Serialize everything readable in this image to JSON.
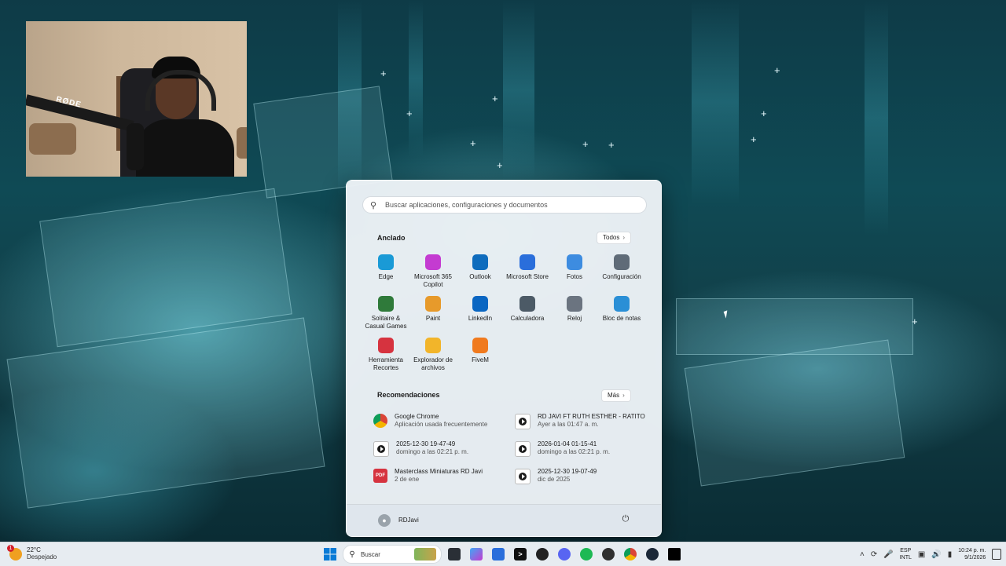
{
  "start_menu": {
    "search_placeholder": "Buscar aplicaciones, configuraciones y documentos",
    "pinned_title": "Anclado",
    "all_button": "Todos",
    "pinned": [
      {
        "label": "Edge",
        "icon": "edge-icon",
        "color": "#1a9ad6"
      },
      {
        "label": "Microsoft 365 Copilot",
        "icon": "m365-copilot-icon",
        "color": "#c43bd1"
      },
      {
        "label": "Outlook",
        "icon": "outlook-icon",
        "color": "#0f6cbd"
      },
      {
        "label": "Microsoft Store",
        "icon": "store-icon",
        "color": "#2a6edb"
      },
      {
        "label": "Fotos",
        "icon": "photos-icon",
        "color": "#3d8ce0"
      },
      {
        "label": "Configuración",
        "icon": "gear-icon",
        "color": "#5f6b78"
      },
      {
        "label": "Solitaire & Casual Games",
        "icon": "solitaire-icon",
        "color": "#2f7a3a"
      },
      {
        "label": "Paint",
        "icon": "paint-icon",
        "color": "#e79a2b"
      },
      {
        "label": "LinkedIn",
        "icon": "linkedin-icon",
        "color": "#0a66c2"
      },
      {
        "label": "Calculadora",
        "icon": "calculator-icon",
        "color": "#4c5a66"
      },
      {
        "label": "Reloj",
        "icon": "clock-icon",
        "color": "#6b7480"
      },
      {
        "label": "Bloc de notas",
        "icon": "notepad-icon",
        "color": "#2a8fd6"
      },
      {
        "label": "Herramienta Recortes",
        "icon": "snipping-tool-icon",
        "color": "#d6333f"
      },
      {
        "label": "Explorador de archivos",
        "icon": "folder-icon",
        "color": "#f2b52a"
      },
      {
        "label": "FiveM",
        "icon": "fivem-icon",
        "color": "#f07a1e"
      }
    ],
    "recs_title": "Recomendaciones",
    "more_button": "Más",
    "recommendations": [
      {
        "name": "Google Chrome",
        "sub": "Aplicación usada frecuentemente",
        "icon": "chrome-icon"
      },
      {
        "name": "RD JAVI FT RUTH ESTHER - RATITO",
        "sub": "Ayer a las 01:47 a. m.",
        "icon": "video-file-icon"
      },
      {
        "name": "2025-12-30 19-47-49",
        "sub": "domingo a las 02:21 p. m.",
        "icon": "video-file-icon"
      },
      {
        "name": "2026-01-04 01-15-41",
        "sub": "domingo a las 02:21 p. m.",
        "icon": "video-file-icon"
      },
      {
        "name": "Masterclass Miniaturas RD Javi",
        "sub": "2 de ene",
        "icon": "pdf-icon"
      },
      {
        "name": "2025-12-30 19-07-49",
        "sub": "dic de 2025",
        "icon": "video-file-icon"
      }
    ],
    "user": "RDJavi"
  },
  "taskbar": {
    "weather_temp": "22°C",
    "weather_cond": "Despejado",
    "weather_badge": "1",
    "search_label": "Buscar",
    "lang_1": "ESP",
    "lang_2": "INTL",
    "time": "10:24 p. m.",
    "date": "9/1/2026"
  },
  "webcam": {
    "mic_brand": "RØDE"
  }
}
